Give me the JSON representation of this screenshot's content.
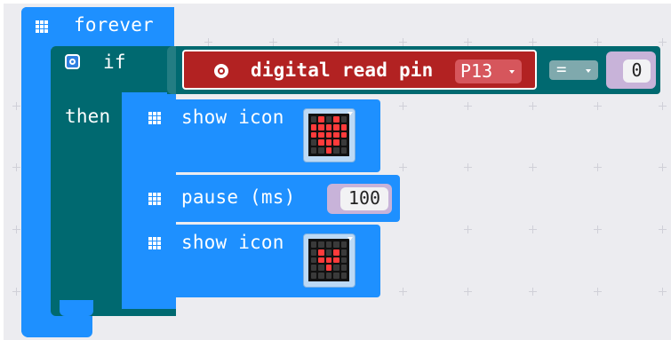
{
  "forever": {
    "label": "forever"
  },
  "if_block": {
    "if_label": "if",
    "then_label": "then"
  },
  "condition": {
    "read_label": "digital read pin",
    "pin_value": "P13",
    "operator": "=",
    "compare_value": "0"
  },
  "show_icon_1": {
    "label": "show icon"
  },
  "pause": {
    "label": "pause (ms)",
    "value": "100"
  },
  "show_icon_2": {
    "label": "show icon"
  },
  "colors": {
    "basic_blue": "#1e90ff",
    "logic_teal": "#006970",
    "pins_red": "#b22222",
    "value_purple": "#c8b3d9"
  },
  "icons": [
    "grid-icon",
    "gear-icon",
    "pin-icon",
    "dropdown-caret-icon"
  ]
}
